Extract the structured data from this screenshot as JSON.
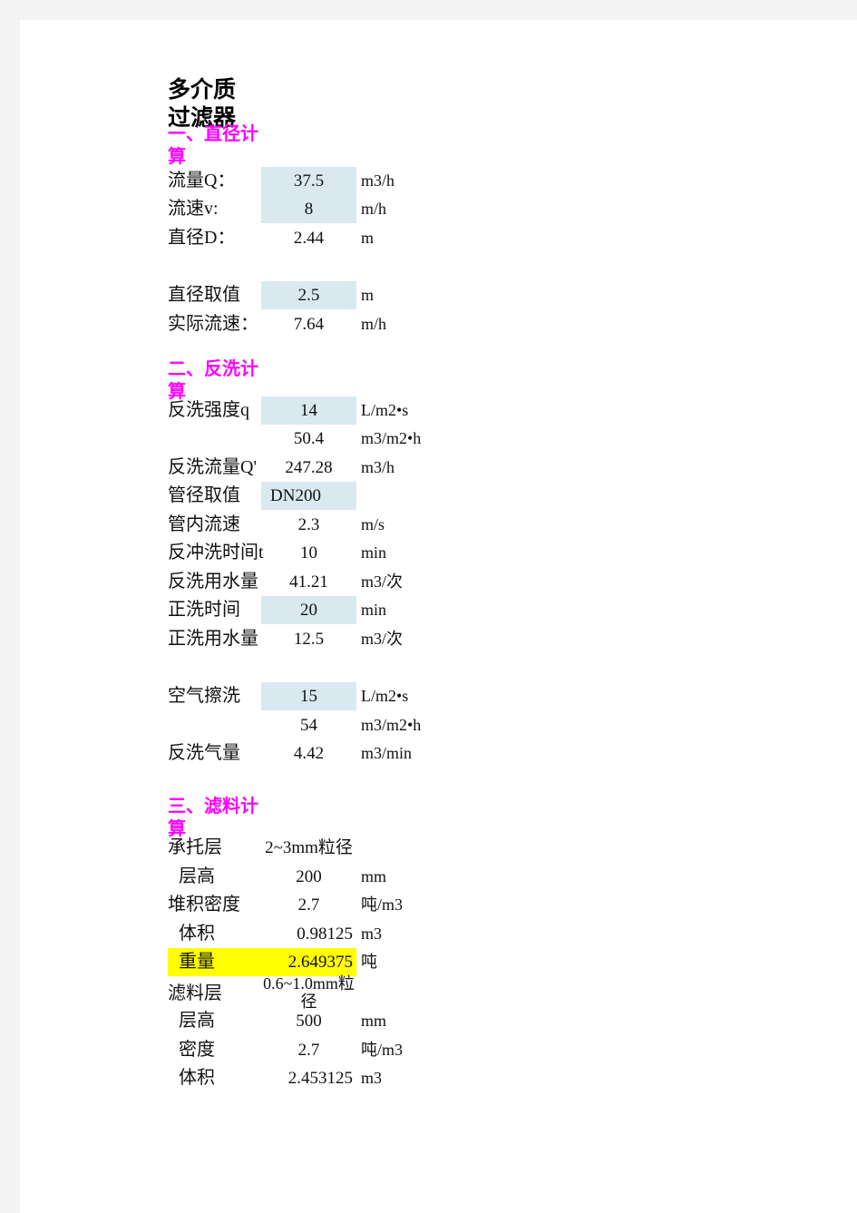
{
  "title": "多介质\n过滤器",
  "sections": [
    {
      "heading": "一、直径计\n算"
    },
    {
      "heading": "二、反洗计\n算"
    },
    {
      "heading": "三、滤料计\n算"
    }
  ],
  "rows": {
    "flow_rate": {
      "label": "流量Q：",
      "value": "37.5",
      "unit": "m3/h"
    },
    "velocity": {
      "label": "流速v:",
      "value": "8",
      "unit": "m/h"
    },
    "diameter": {
      "label": "直径D：",
      "value": "2.44",
      "unit": "m"
    },
    "diameter_chosen": {
      "label": "直径取值",
      "value": "2.5",
      "unit": "m"
    },
    "actual_velocity": {
      "label": "实际流速：",
      "value": "7.64",
      "unit": "m/h"
    },
    "backwash_intensity": {
      "label": "反洗强度q",
      "value": "14",
      "unit": "L/m2•s"
    },
    "backwash_intensity_h": {
      "label": "",
      "value": "50.4",
      "unit": "m3/m2•h"
    },
    "backwash_flow": {
      "label": "反洗流量Q'",
      "value": "247.28",
      "unit": "m3/h"
    },
    "pipe_diameter": {
      "label": "管径取值",
      "value": "DN200",
      "unit": ""
    },
    "pipe_velocity": {
      "label": "管内流速",
      "value": "2.3",
      "unit": "m/s"
    },
    "backwash_time": {
      "label": "反冲洗时间t",
      "value": "10",
      "unit": "min"
    },
    "backwash_water": {
      "label": "反洗用水量",
      "value": "41.21",
      "unit": "m3/次"
    },
    "rinse_time": {
      "label": "正洗时间",
      "value": "20",
      "unit": "min"
    },
    "rinse_water": {
      "label": "正洗用水量",
      "value": "12.5",
      "unit": "m3/次"
    },
    "air_scour": {
      "label": "空气擦洗",
      "value": "15",
      "unit": "L/m2•s"
    },
    "air_scour_h": {
      "label": "",
      "value": "54",
      "unit": "m3/m2•h"
    },
    "backwash_air": {
      "label": "反洗气量",
      "value": "4.42",
      "unit": "m3/min"
    },
    "support_layer": {
      "label": "承托层",
      "value": "2~3mm粒径",
      "unit": ""
    },
    "support_height": {
      "label": "层高",
      "value": "200",
      "unit": "mm"
    },
    "support_density": {
      "label": "堆积密度",
      "value": "2.7",
      "unit": "吨/m3"
    },
    "support_volume": {
      "label": "体积",
      "value": "0.98125",
      "unit": "m3"
    },
    "support_weight": {
      "label": "重量",
      "value": "2.649375",
      "unit": "吨"
    },
    "media_layer": {
      "label": "滤料层",
      "value": "0.6~1.0mm粒径",
      "unit": ""
    },
    "media_height": {
      "label": "层高",
      "value": "500",
      "unit": "mm"
    },
    "media_density": {
      "label": "密度",
      "value": "2.7",
      "unit": "吨/m3"
    },
    "media_volume": {
      "label": "体积",
      "value": "2.453125",
      "unit": "m3"
    }
  },
  "colors": {
    "input_cell": "#d9e9ef",
    "highlight": "#ffff00",
    "heading": "#ff00ff",
    "page": "#ffffff",
    "margin": "#f4f4f4"
  }
}
